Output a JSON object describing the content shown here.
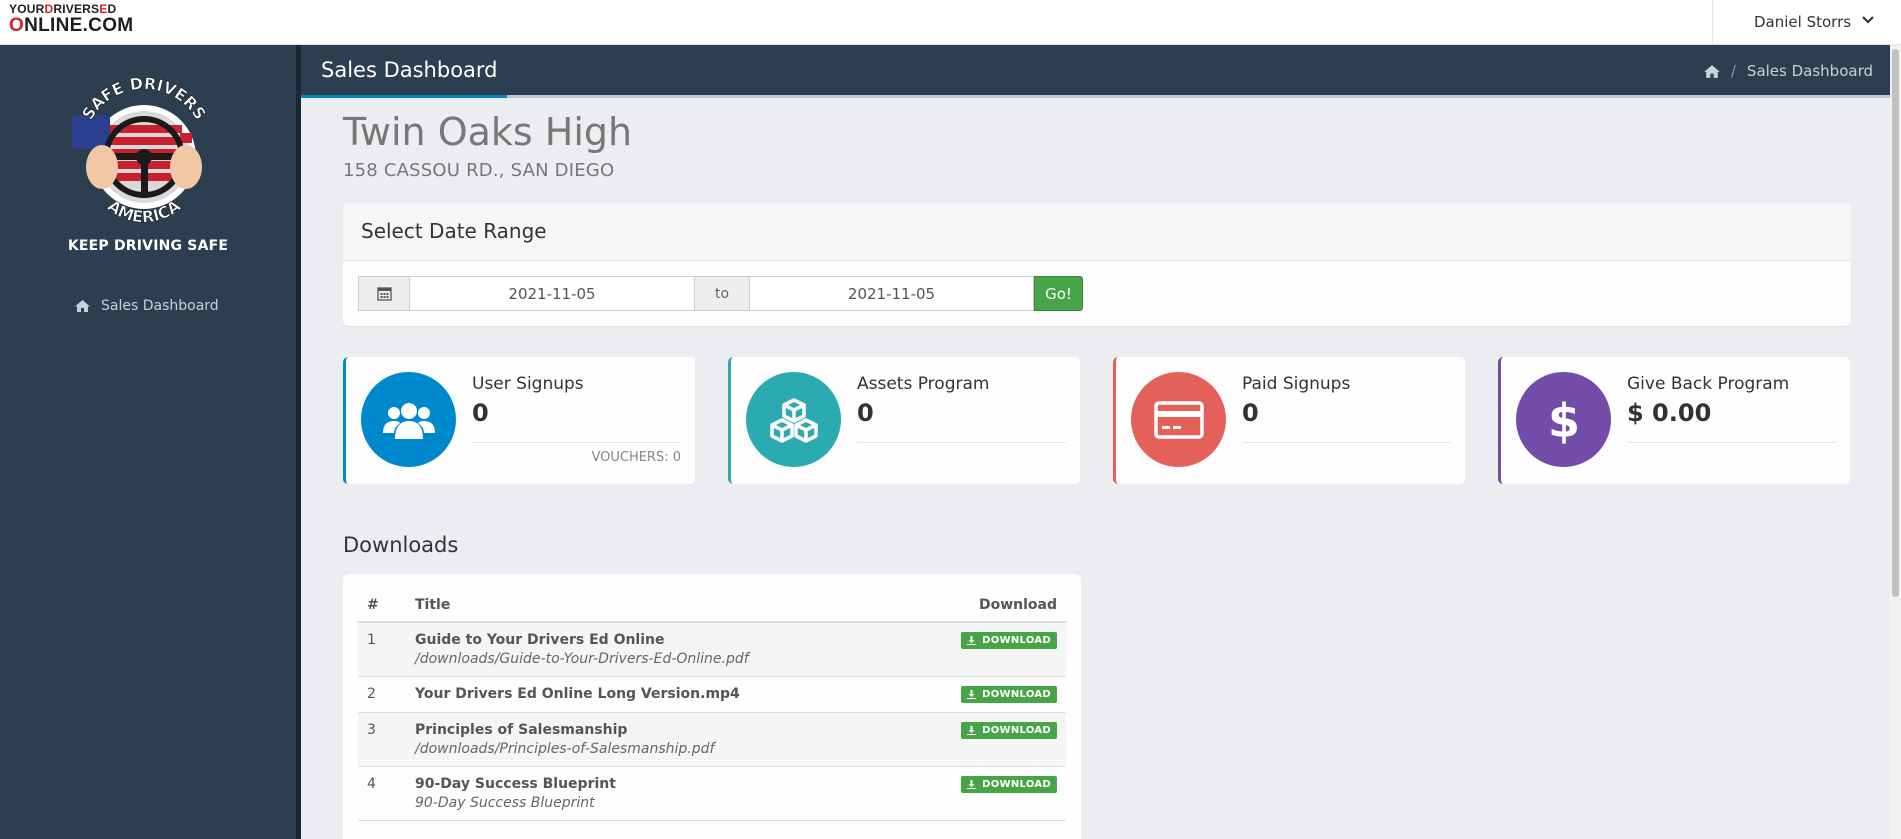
{
  "logo": {
    "line1_prefix": "YOUR",
    "line1_red": "D",
    "line1_mid": "RIVERS",
    "line1_red2": "E",
    "line1_suffix": "D",
    "line2_red": "O",
    "line2_rest": "NLINE.COM"
  },
  "user": {
    "name": "Daniel Storrs",
    "icon": "chevron-down-icon"
  },
  "sidebar": {
    "badge": {
      "top_text": "SAFE DRIVERS",
      "bottom_text": "AMERICA"
    },
    "tagline": "KEEP DRIVING SAFE",
    "items": [
      {
        "label": "Sales Dashboard",
        "icon": "home-icon"
      }
    ]
  },
  "header": {
    "title": "Sales Dashboard",
    "breadcrumb": {
      "icon": "home-icon",
      "separator": "/",
      "current": "Sales Dashboard"
    }
  },
  "school": {
    "name": "Twin Oaks High",
    "address": "158 CASSOU RD., SAN DIEGO"
  },
  "date_range": {
    "title": "Select Date Range",
    "from": "2021-11-05",
    "to_label": "to",
    "to": "2021-11-05",
    "go_label": "Go!",
    "icon": "calendar-icon"
  },
  "stats": [
    {
      "title": "User Signups",
      "value": "0",
      "footer": "VOUCHERS: 0",
      "color": "#0088cc",
      "icon": "users-icon"
    },
    {
      "title": "Assets Program",
      "value": "0",
      "footer": "",
      "color": "#2baab1",
      "icon": "cubes-icon"
    },
    {
      "title": "Paid Signups",
      "value": "0",
      "footer": "",
      "color": "#e36159",
      "icon": "credit-card-icon"
    },
    {
      "title": "Give Back Program",
      "value": "$ 0.00",
      "footer": "",
      "color": "#734ba9",
      "icon": "dollar-icon"
    }
  ],
  "downloads": {
    "title": "Downloads",
    "columns": [
      "#",
      "Title",
      "Download"
    ],
    "button_label": "DOWNLOAD",
    "rows": [
      {
        "num": "1",
        "title": "Guide to Your Drivers Ed Online",
        "path": "/downloads/Guide-to-Your-Drivers-Ed-Online.pdf"
      },
      {
        "num": "2",
        "title": "Your Drivers Ed Online Long Version.mp4",
        "path": ""
      },
      {
        "num": "3",
        "title": "Principles of Salesmanship",
        "path": "/downloads/Principles-of-Salesmanship.pdf"
      },
      {
        "num": "4",
        "title": "90-Day Success Blueprint",
        "path": "90-Day Success Blueprint"
      }
    ]
  }
}
